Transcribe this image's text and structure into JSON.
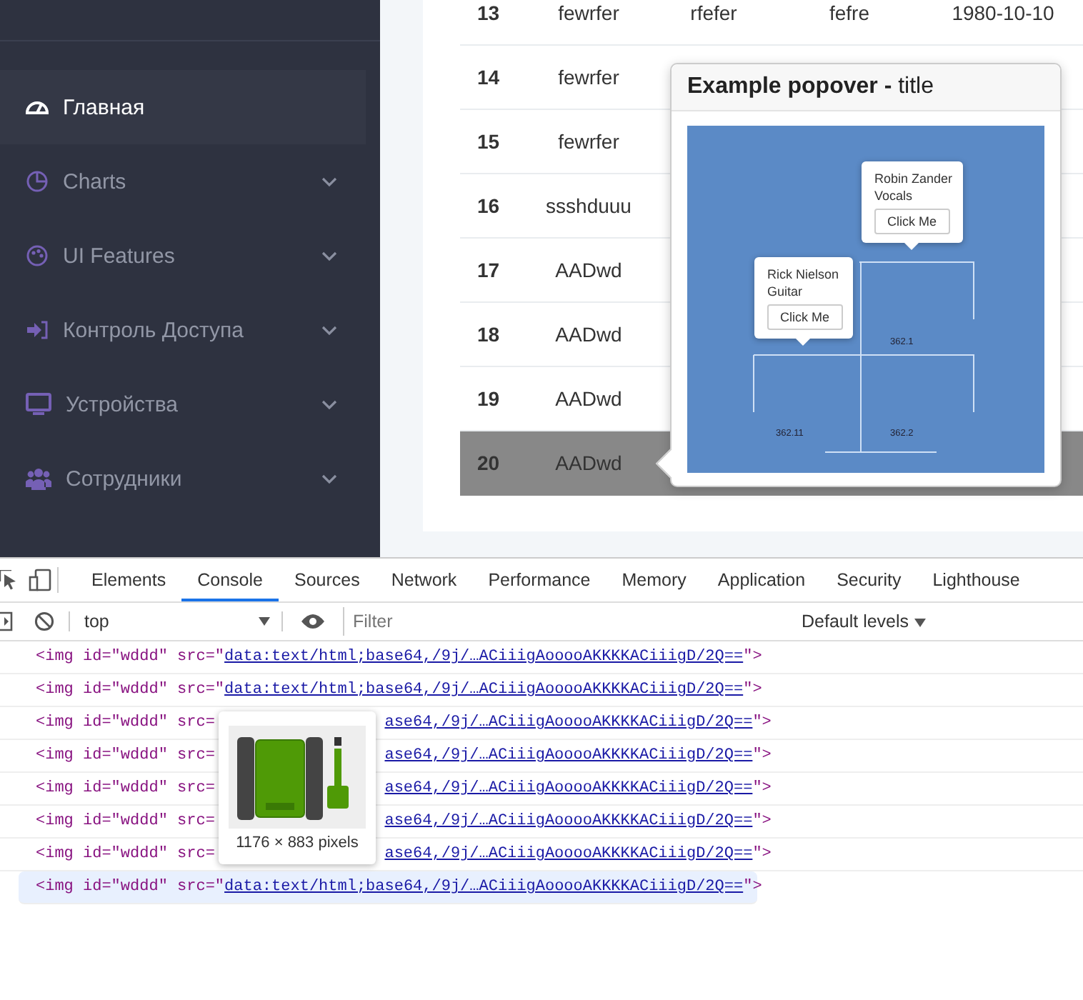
{
  "sidebar": {
    "items": [
      {
        "label": "Главная",
        "selected": true,
        "expandable": false
      },
      {
        "label": "Charts",
        "selected": false,
        "expandable": true
      },
      {
        "label": "UI Features",
        "selected": false,
        "expandable": true
      },
      {
        "label": "Контроль Доступа",
        "selected": false,
        "expandable": true
      },
      {
        "label": "Устройства",
        "selected": false,
        "expandable": true
      },
      {
        "label": "Сотрудники",
        "selected": false,
        "expandable": true
      }
    ]
  },
  "table": {
    "rows": [
      {
        "cells": [
          "13",
          "fewrfer",
          "rfefer",
          "fefre",
          "1980-10-10"
        ],
        "selected": false
      },
      {
        "cells": [
          "14",
          "fewrfer"
        ],
        "selected": false
      },
      {
        "cells": [
          "15",
          "fewrfer"
        ],
        "selected": false
      },
      {
        "cells": [
          "16",
          "ssshduuu"
        ],
        "selected": false
      },
      {
        "cells": [
          "17",
          "AADwd"
        ],
        "selected": false
      },
      {
        "cells": [
          "18",
          "AADwd"
        ],
        "selected": false
      },
      {
        "cells": [
          "19",
          "AADwd"
        ],
        "selected": false
      },
      {
        "cells": [
          "20",
          "AADwd"
        ],
        "selected": true
      }
    ]
  },
  "popover": {
    "title": "**Example popover -** title",
    "screenshot": {
      "cards": [
        {
          "name": "Robin Zander",
          "role": "Vocals",
          "button": "Click Me"
        },
        {
          "name": "Rick Nielson",
          "role": "Guitar",
          "button": "Click Me"
        }
      ],
      "labels": [
        "362.1",
        "362.11",
        "362.2"
      ]
    }
  },
  "devtools": {
    "tabs": [
      {
        "label": "Elements",
        "selected": false
      },
      {
        "label": "Console",
        "selected": true
      },
      {
        "label": "Sources",
        "selected": false
      },
      {
        "label": "Network",
        "selected": false
      },
      {
        "label": "Performance",
        "selected": false
      },
      {
        "label": "Memory",
        "selected": false
      },
      {
        "label": "Application",
        "selected": false
      },
      {
        "label": "Security",
        "selected": false
      },
      {
        "label": "Lighthouse",
        "selected": false
      }
    ],
    "context": "top",
    "filter_placeholder": "Filter",
    "levels": "Default levels",
    "log": [
      {
        "kind": "full",
        "prefix": "<img id=\"wddd\" src=\"",
        "link": "data:text/html;base64,/9j/…ACiiigAooooAKKKKACiiigD/2Q==",
        "suffix": "\">",
        "selected": false
      },
      {
        "kind": "full",
        "prefix": "<img id=\"wddd\" src=\"",
        "link": "data:text/html;base64,/9j/…ACiiigAooooAKKKKACiiigD/2Q==",
        "suffix": "\">",
        "selected": false
      },
      {
        "kind": "partial",
        "prefix": "<img id=\"wddd\" src=",
        "link": "ase64,/9j/…ACiiigAooooAKKKKACiiigD/2Q==",
        "suffix": "\">",
        "selected": false
      },
      {
        "kind": "partial",
        "prefix": "<img id=\"wddd\" src=",
        "link": "ase64,/9j/…ACiiigAooooAKKKKACiiigD/2Q==",
        "suffix": "\">",
        "selected": false
      },
      {
        "kind": "partial",
        "prefix": "<img id=\"wddd\" src=",
        "link": "ase64,/9j/…ACiiigAooooAKKKKACiiigD/2Q==",
        "suffix": "\">",
        "selected": false
      },
      {
        "kind": "partial",
        "prefix": "<img id=\"wddd\" src=",
        "link": "ase64,/9j/…ACiiigAooooAKKKKACiiigD/2Q==",
        "suffix": "\">",
        "selected": false
      },
      {
        "kind": "partial",
        "prefix": "<img id=\"wddd\" src=",
        "link": "ase64,/9j/…ACiiigAooooAKKKKACiiigD/2Q==",
        "suffix": "\">",
        "selected": false
      },
      {
        "kind": "full",
        "prefix": "<img id=\"wddd\" src=\"",
        "link": "data:text/html;base64,/9j/…ACiiigAooooAKKKKACiiigD/2Q==",
        "suffix": "\">",
        "selected": true
      }
    ],
    "tooltip": {
      "caption": "1176 × 883 pixels"
    }
  }
}
